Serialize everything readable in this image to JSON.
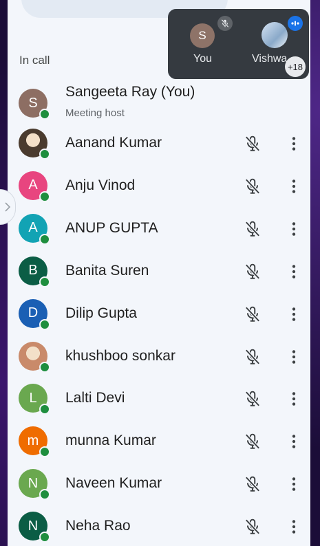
{
  "section_title": "In call",
  "participants": [
    {
      "name": "Sangeeta Ray (You)",
      "subtitle": "Meeting host",
      "initial": "S",
      "color": "#8d6e63",
      "photo": false
    },
    {
      "name": "Aanand Kumar",
      "initial": "",
      "color": "#4a3b2e",
      "photo": true
    },
    {
      "name": "Anju Vinod",
      "initial": "A",
      "color": "#e8457f",
      "photo": false
    },
    {
      "name": "ANUP GUPTA",
      "initial": "A",
      "color": "#12a3b4",
      "photo": false
    },
    {
      "name": "Banita Suren",
      "initial": "B",
      "color": "#0b5d45",
      "photo": false
    },
    {
      "name": "Dilip Gupta",
      "initial": "D",
      "color": "#1a5fb4",
      "photo": false
    },
    {
      "name": "khushboo sonkar",
      "initial": "",
      "color": "#c98a6a",
      "photo": true
    },
    {
      "name": "Lalti Devi",
      "initial": "L",
      "color": "#6aa84f",
      "photo": false
    },
    {
      "name": "munna Kumar",
      "initial": "m",
      "color": "#ef6c00",
      "photo": false
    },
    {
      "name": "Naveen Kumar",
      "initial": "N",
      "color": "#6aa84f",
      "photo": false
    },
    {
      "name": "Neha Rao",
      "initial": "N",
      "color": "#0b5d45",
      "photo": false
    }
  ],
  "overlay": {
    "you_initial": "S",
    "you_label": "You",
    "other_label": "Vishwa",
    "more_count": "+18"
  },
  "colors": {
    "online": "#1e8e3e",
    "panel_bg": "#f3f6fb",
    "overlay_bg": "#353a40",
    "speaking": "#1a73e8"
  }
}
